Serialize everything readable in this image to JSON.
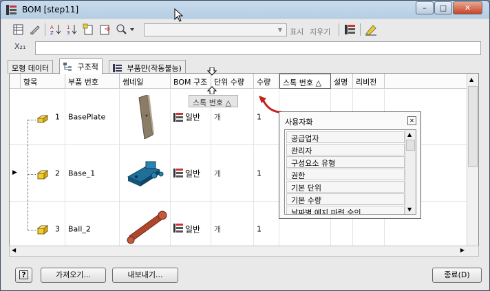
{
  "window": {
    "title": "BOM [step11]"
  },
  "title_buttons": {
    "minimize": "–",
    "maximize": "□",
    "close": "✕"
  },
  "toolbar": {
    "show_label": "표시",
    "clear_label": "지우기"
  },
  "formula": {
    "fx_label": "X₂₁"
  },
  "tabs": [
    {
      "label": "모형 데이터"
    },
    {
      "label": "구조적"
    },
    {
      "label": "부품만(작동불능)"
    }
  ],
  "columns": [
    "항목",
    "부품 번호",
    "썸네일",
    "BOM 구조",
    "단위 수량",
    "수량",
    "스톡 번호 △",
    "설명",
    "리비전"
  ],
  "drag_label": "스톡 번호 △",
  "rows": [
    {
      "item": "1",
      "part": "BasePlate",
      "bom": "일반",
      "unit": "개",
      "qty": "1"
    },
    {
      "item": "2",
      "part": "Base_1",
      "bom": "일반",
      "unit": "개",
      "qty": "1"
    },
    {
      "item": "3",
      "part": "Ball_2",
      "bom": "일반",
      "unit": "개",
      "qty": "1"
    }
  ],
  "customize": {
    "title": "사용자화",
    "items": [
      "공급업자",
      "관리자",
      "구성요소 유형",
      "권한",
      "기본 단위",
      "기본 수량",
      "날짜별 예지 마련 승인"
    ]
  },
  "footer": {
    "import": "가져오기...",
    "export": "내보내기...",
    "close": "종료(D)"
  },
  "colors": {
    "thumb_plate": "#8a7c66",
    "thumb_base": "#1f6f99",
    "thumb_ball": "#b0472d",
    "icon_yellow": "#f2cc2a"
  }
}
